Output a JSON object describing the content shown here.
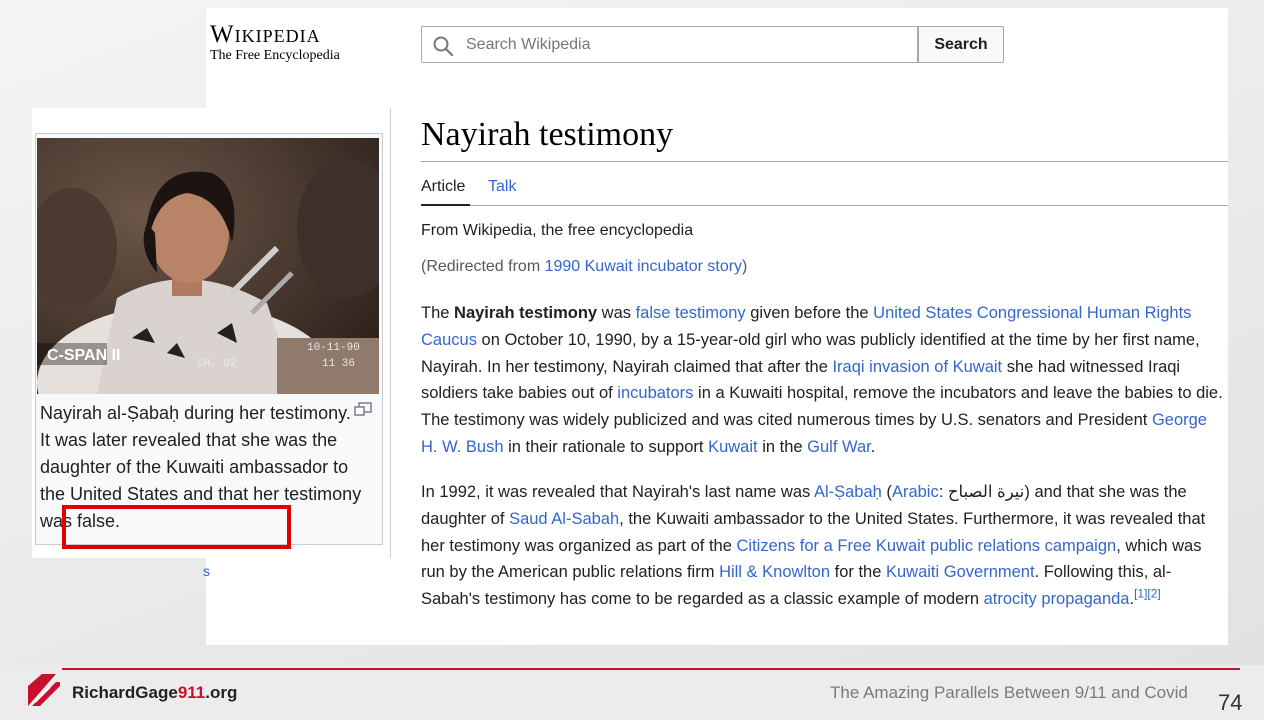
{
  "wiki": {
    "logo_word": "Wikipedia",
    "logo_tagline": "The Free Encyclopedia",
    "search_placeholder": "Search Wikipedia",
    "search_button": "Search",
    "title": "Nayirah testimony",
    "tabs": [
      "Article",
      "Talk"
    ],
    "tagline": "From Wikipedia, the free encyclopedia",
    "redirect_prefix": "(Redirected from ",
    "redirect_link": "1990 Kuwait incubator story",
    "redirect_suffix": ")"
  },
  "paragraph1": [
    {
      "t": "The "
    },
    {
      "t": "Nayirah testimony",
      "b": true
    },
    {
      "t": " was "
    },
    {
      "t": "false testimony",
      "l": true
    },
    {
      "t": " given before the "
    },
    {
      "t": "United States Congressional Human Rights Caucus",
      "l": true
    },
    {
      "t": " on October 10, 1990, by a 15-year-old girl who was publicly identified at the time by her first name, Nayirah. In her testimony, Nayirah claimed that after the "
    },
    {
      "t": "Iraqi invasion of Kuwait",
      "l": true
    },
    {
      "t": " she had witnessed Iraqi soldiers take babies out of "
    },
    {
      "t": "incubators",
      "l": true
    },
    {
      "t": " in a Kuwaiti hospital, remove the incubators and leave the babies to die. The testimony was widely publicized and was cited numerous times by U.S. senators and President "
    },
    {
      "t": "George H. W. Bush",
      "l": true
    },
    {
      "t": " in their rationale to support "
    },
    {
      "t": "Kuwait",
      "l": true
    },
    {
      "t": " in the "
    },
    {
      "t": "Gulf War",
      "l": true
    },
    {
      "t": "."
    }
  ],
  "paragraph2": [
    {
      "t": "In 1992, it was revealed that Nayirah's last name was "
    },
    {
      "t": "Al-Ṣabaḥ",
      "l": true
    },
    {
      "t": " ("
    },
    {
      "t": "Arabic",
      "l": true
    },
    {
      "t": ": نيرة الصباح) and that she was the daughter of "
    },
    {
      "t": "Saud Al-Sabah",
      "l": true
    },
    {
      "t": ", the Kuwaiti ambassador to the United States. Furthermore, it was revealed that her testimony was organized as part of the "
    },
    {
      "t": "Citizens for a Free Kuwait public relations campaign",
      "l": true
    },
    {
      "t": ", which was run by the American public relations firm "
    },
    {
      "t": "Hill & Knowlton",
      "l": true
    },
    {
      "t": " for the "
    },
    {
      "t": "Kuwaiti Government",
      "l": true
    },
    {
      "t": ". Following this, al-Sabah's testimony has come to be regarded as a classic example of modern "
    },
    {
      "t": "atrocity propaganda",
      "l": true
    },
    {
      "t": "."
    },
    {
      "t": "[1][2]",
      "sup": true
    }
  ],
  "infobox": {
    "photo_overlay_logo": "C-SPAN II",
    "photo_overlay_date": "10-11-90",
    "photo_overlay_channel": "CH. 02",
    "photo_overlay_time": "11 36",
    "caption": "Nayirah al-Ṣabaḥ during her testimony. It was later revealed that she was the daughter of the Kuwaiti ambassador to the United States and that her testimony was false."
  },
  "stray_char": "s",
  "footer": {
    "brand_part1": "RichardGage",
    "brand_part2": "911",
    "brand_part3": ".org",
    "title": "The Amazing Parallels Between 9/11 and Covid",
    "page_number": "74"
  },
  "colors": {
    "link": "#3366cc",
    "highlight": "#e00000",
    "brand_red": "#c8102e"
  }
}
